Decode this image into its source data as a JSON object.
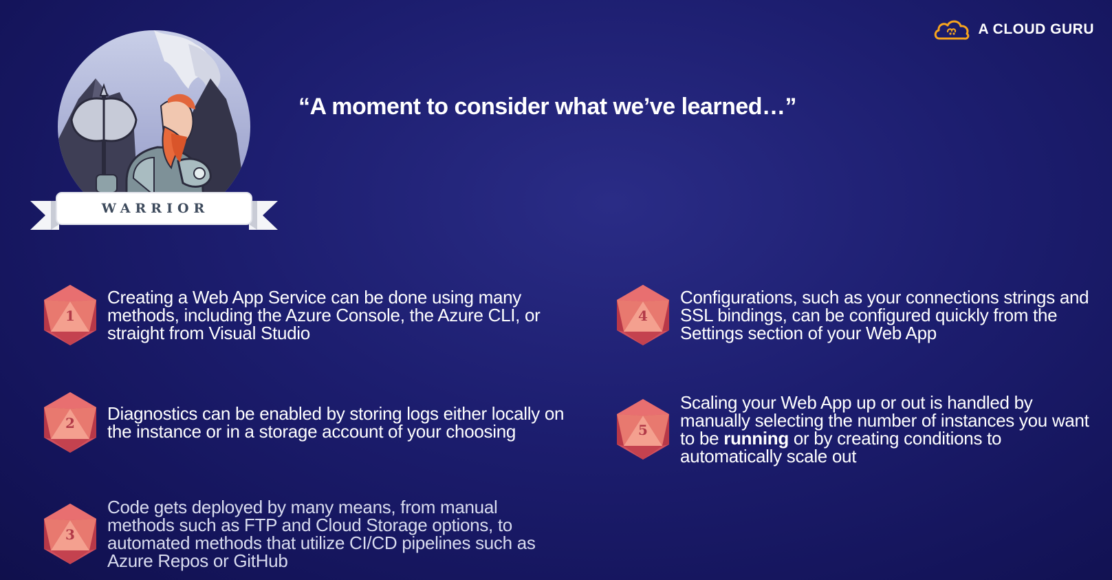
{
  "brand": {
    "logo_text": "A CLOUD GURU",
    "accent": "#f7a51e"
  },
  "badge": {
    "label": "WARRIOR",
    "icon": "warrior-character"
  },
  "heading": "“A moment to consider what we’ve learned…”",
  "colors": {
    "background": "#1c1d6e",
    "d20_light": "#f08a7c",
    "d20_dark": "#d2505e",
    "d20_number": "#b23a48"
  },
  "items": [
    {
      "number": "1",
      "text": "Creating a Web App Service can be done using many methods, including the Azure Console, the Azure CLI, or straight from Visual Studio"
    },
    {
      "number": "2",
      "text": "Diagnostics can be enabled by storing logs either locally on the instance or in a storage account of your choosing"
    },
    {
      "number": "3",
      "text": "Code gets deployed by many means, from manual methods such as FTP and Cloud Storage options, to automated methods that utilize CI/CD pipelines such as Azure Repos or GitHub"
    },
    {
      "number": "4",
      "text": "Configurations, such as your connections strings and SSL bindings, can be configured quickly from the Settings section of your Web App"
    },
    {
      "number": "5",
      "text_before": "Scaling your Web App up or out is handled by manually selecting the number of instances you want to be ",
      "text_bold": "running",
      "text_after": " or by creating conditions to automatically scale out"
    }
  ]
}
